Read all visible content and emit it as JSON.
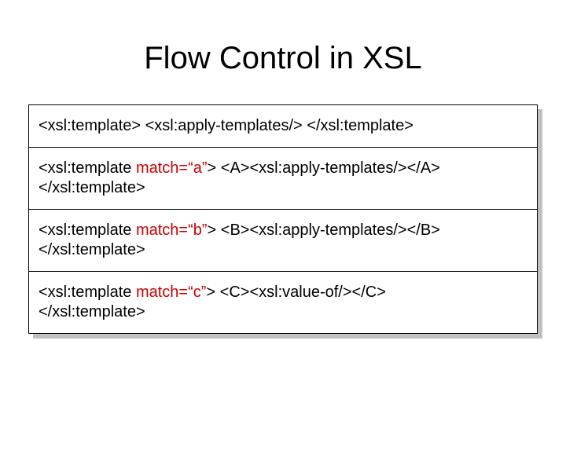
{
  "title": "Flow Control in XSL",
  "rows": [
    {
      "p1": "<xsl:template> <xsl:apply-templates/> </xsl:template>",
      "attr": "",
      "p2": "",
      "p3": ""
    },
    {
      "p1": "<xsl:template ",
      "attr": "match=“a”",
      "p2": ">  <A><xsl:apply-templates/></A>",
      "p3": "</xsl:template>"
    },
    {
      "p1": "<xsl:template ",
      "attr": "match=“b”",
      "p2": ">  <B><xsl:apply-templates/></B>",
      "p3": "</xsl:template>"
    },
    {
      "p1": "<xsl:template ",
      "attr": "match=“c”",
      "p2": ">  <C><xsl:value-of/></C>",
      "p3": "</xsl:template>"
    }
  ]
}
